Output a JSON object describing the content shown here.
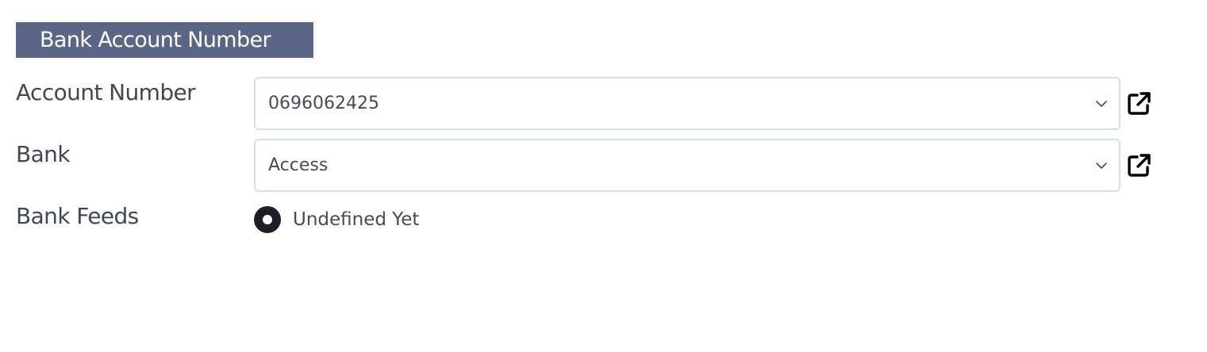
{
  "section": {
    "title": "Bank Account Number"
  },
  "fields": {
    "account_number": {
      "label": "Account Number",
      "value": "0696062425"
    },
    "bank": {
      "label": "Bank",
      "value": "Access"
    },
    "bank_feeds": {
      "label": "Bank Feeds",
      "option_label": "Undefined Yet",
      "selected": true
    }
  },
  "icons": {
    "dropdown": "chevron-down-icon",
    "open": "external-link-icon"
  },
  "colors": {
    "header_bg": "#5b6585",
    "label_text": "#3d4759",
    "border": "#dadde7",
    "radio_fill": "#1d1d26"
  }
}
